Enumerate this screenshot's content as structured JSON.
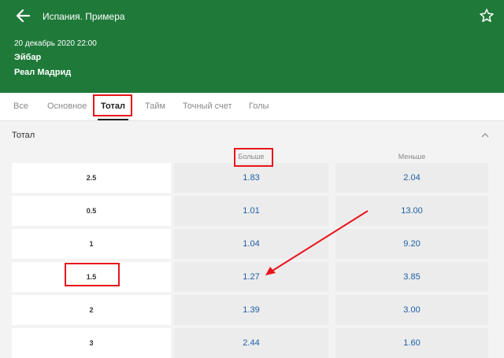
{
  "header": {
    "league": "Испания. Примера",
    "datetime": "20 декабрь 2020 22:00",
    "team_home": "Эйбар",
    "team_away": "Реал Мадрид",
    "back_icon": "arrow-left-icon",
    "favorite_icon": "star-outline-icon"
  },
  "tabs": [
    {
      "label": "Все"
    },
    {
      "label": "Основное"
    },
    {
      "label": "Тотал",
      "active": true
    },
    {
      "label": "Тайм"
    },
    {
      "label": "Точный счет"
    },
    {
      "label": "Голы"
    }
  ],
  "market": {
    "title": "Тотал",
    "collapse_icon": "chevron-up-icon",
    "col_over": "Больше",
    "col_under": "Меньше",
    "rows": [
      {
        "line": "2.5",
        "over": "1.83",
        "under": "2.04"
      },
      {
        "line": "0.5",
        "over": "1.01",
        "under": "13.00"
      },
      {
        "line": "1",
        "over": "1.04",
        "under": "9.20"
      },
      {
        "line": "1.5",
        "over": "1.27",
        "under": "3.85"
      },
      {
        "line": "2",
        "over": "1.39",
        "under": "3.00"
      },
      {
        "line": "3",
        "over": "2.44",
        "under": "1.60"
      }
    ]
  },
  "colors": {
    "header_bg": "#1f7a3a",
    "odds_text": "#1d5fa8",
    "annotation": "#e8141c"
  }
}
